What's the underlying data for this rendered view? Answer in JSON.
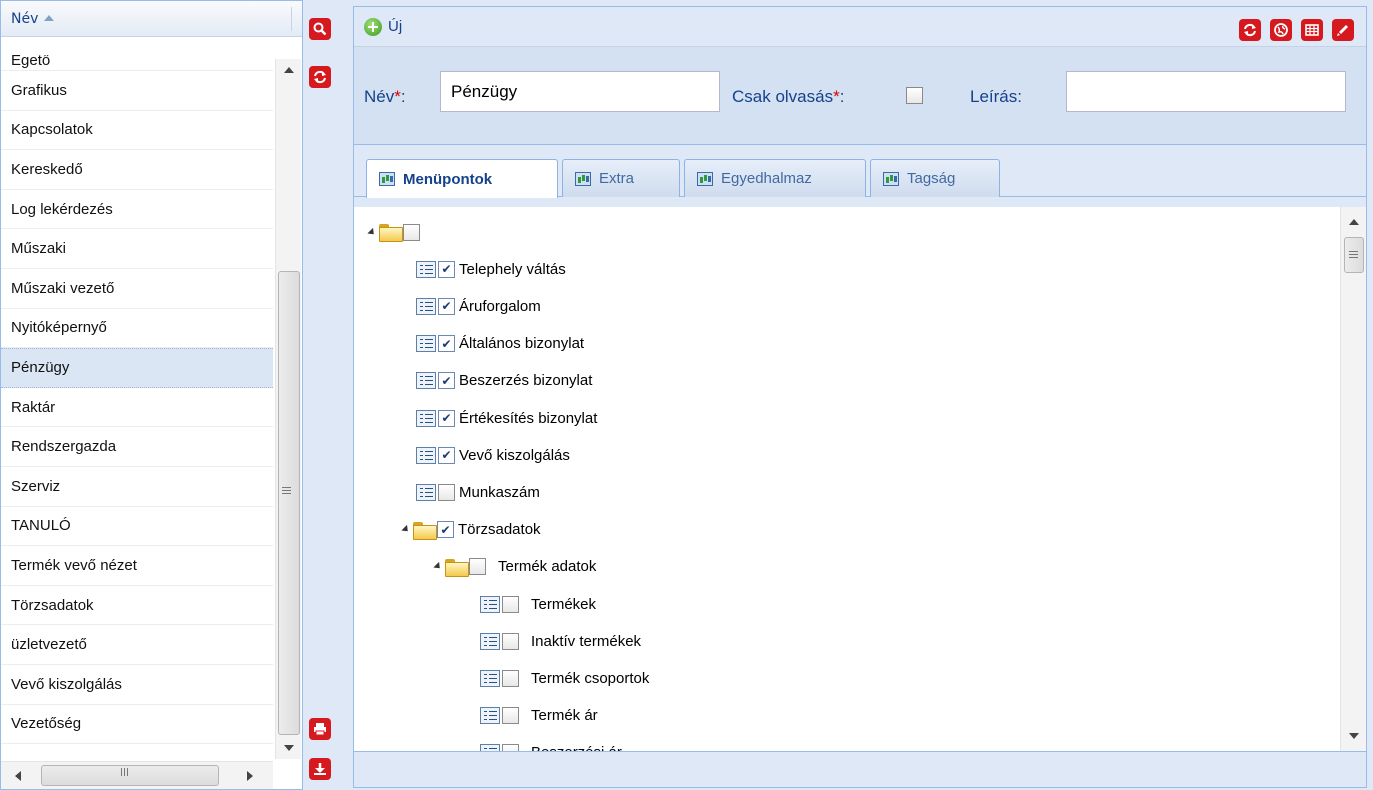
{
  "list": {
    "column_header": "Név",
    "items": [
      {
        "label": "Égető",
        "selected": false
      },
      {
        "label": "Grafikus",
        "selected": false
      },
      {
        "label": "Kapcsolatok",
        "selected": false
      },
      {
        "label": "Kereskedő",
        "selected": false
      },
      {
        "label": "Log lekérdezés",
        "selected": false
      },
      {
        "label": "Műszaki",
        "selected": false
      },
      {
        "label": "Műszaki vezető",
        "selected": false
      },
      {
        "label": "Nyitóképernyő",
        "selected": false
      },
      {
        "label": "Pénzügy",
        "selected": true
      },
      {
        "label": "Raktár",
        "selected": false
      },
      {
        "label": "Rendszergazda",
        "selected": false
      },
      {
        "label": "Szerviz",
        "selected": false
      },
      {
        "label": "TANULÓ",
        "selected": false
      },
      {
        "label": "Termék vevő nézet",
        "selected": false
      },
      {
        "label": "Törzsadatok",
        "selected": false
      },
      {
        "label": "üzletvezető",
        "selected": false
      },
      {
        "label": "Vevő kiszolgálás",
        "selected": false
      },
      {
        "label": "Vezetőség",
        "selected": false
      }
    ]
  },
  "side_toolbar": {
    "icons": [
      "search-icon",
      "refresh-icon",
      "print-icon",
      "download-icon"
    ]
  },
  "toolbar": {
    "new_label": "Új",
    "right_icons": [
      "refresh-icon",
      "globe-icon",
      "grid-icon",
      "edit-icon"
    ]
  },
  "form": {
    "name_label": "Név",
    "name_value": "Pénzügy",
    "readonly_label": "Csak olvasás",
    "readonly_checked": false,
    "desc_label": "Leírás:",
    "desc_value": "",
    "required_mark": "*",
    "colon": ":"
  },
  "tabs": [
    {
      "label": "Menüpontok",
      "active": true
    },
    {
      "label": "Extra",
      "active": false
    },
    {
      "label": "Egyedhalmaz",
      "active": false
    },
    {
      "label": "Tagság",
      "active": false
    }
  ],
  "tree": [
    {
      "label": "",
      "type": "folder",
      "level": 0,
      "checked": false,
      "expanded": true
    },
    {
      "label": "Telephely váltás",
      "type": "leaf",
      "level": 1,
      "checked": true
    },
    {
      "label": "Áruforgalom",
      "type": "leaf",
      "level": 1,
      "checked": true
    },
    {
      "label": "Általános bizonylat",
      "type": "leaf",
      "level": 1,
      "checked": true
    },
    {
      "label": "Beszerzés bizonylat",
      "type": "leaf",
      "level": 1,
      "checked": true
    },
    {
      "label": "Értékesítés bizonylat",
      "type": "leaf",
      "level": 1,
      "checked": true
    },
    {
      "label": "Vevő kiszolgálás",
      "type": "leaf",
      "level": 1,
      "checked": true
    },
    {
      "label": "Munkaszám",
      "type": "leaf",
      "level": 1,
      "checked": false
    },
    {
      "label": "Törzsadatok",
      "type": "folder",
      "level": 1,
      "checked": true,
      "expanded": true
    },
    {
      "label": "Termék adatok",
      "type": "folder",
      "level": 2,
      "checked": false,
      "expanded": true
    },
    {
      "label": "Termékek",
      "type": "leaf",
      "level": 3,
      "checked": false
    },
    {
      "label": "Inaktív termékek",
      "type": "leaf",
      "level": 3,
      "checked": false
    },
    {
      "label": "Termék csoportok",
      "type": "leaf",
      "level": 3,
      "checked": false
    },
    {
      "label": "Termék ár",
      "type": "leaf",
      "level": 3,
      "checked": false
    },
    {
      "label": "Beszerzési ár",
      "type": "leaf",
      "level": 3,
      "checked": false
    }
  ],
  "colors": {
    "accent_red": "#d6191f",
    "header_blue": "#15428b",
    "panel_bg": "#dfe8f6",
    "selected_row": "#dbe6f4"
  }
}
